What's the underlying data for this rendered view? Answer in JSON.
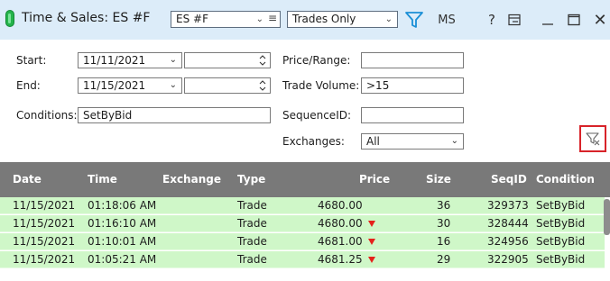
{
  "window": {
    "title": "Time & Sales: ES #F",
    "symbol": "ES #F",
    "filter_mode": "Trades Only",
    "ms_label": "MS",
    "help_label": "?"
  },
  "filters": {
    "start_label": "Start:",
    "start_date": "11/11/2021",
    "start_time": "",
    "end_label": "End:",
    "end_date": "11/15/2021",
    "end_time": "",
    "conditions_label": "Conditions:",
    "conditions_value": "SetByBid",
    "price_range_label": "Price/Range:",
    "price_range_value": "",
    "trade_volume_label": "Trade Volume:",
    "trade_volume_value": ">15",
    "sequence_id_label": "SequenceID:",
    "sequence_id_value": "",
    "exchanges_label": "Exchanges:",
    "exchanges_value": "All"
  },
  "grid": {
    "columns": [
      "Date",
      "Time",
      "Exchange",
      "Type",
      "Price",
      "Size",
      "SeqID",
      "Condition"
    ],
    "rows": [
      {
        "date": "11/15/2021",
        "time": "01:18:06 AM",
        "exchange": "",
        "type": "Trade",
        "price": "4680.00",
        "tick": "",
        "size": "36",
        "seqid": "329373",
        "condition": "SetByBid"
      },
      {
        "date": "11/15/2021",
        "time": "01:16:10 AM",
        "exchange": "",
        "type": "Trade",
        "price": "4680.00",
        "tick": "down",
        "size": "30",
        "seqid": "328444",
        "condition": "SetByBid"
      },
      {
        "date": "11/15/2021",
        "time": "01:10:01 AM",
        "exchange": "",
        "type": "Trade",
        "price": "4681.00",
        "tick": "down",
        "size": "16",
        "seqid": "324956",
        "condition": "SetByBid"
      },
      {
        "date": "11/15/2021",
        "time": "01:05:21 AM",
        "exchange": "",
        "type": "Trade",
        "price": "4681.25",
        "tick": "down",
        "size": "29",
        "seqid": "322905",
        "condition": "SetByBid"
      }
    ]
  },
  "colors": {
    "title_bar": "#dcecf9",
    "header_bg": "#797979",
    "row_bg": "#cff7c8",
    "down_tick": "#e5221b",
    "highlight_box": "#d8232a",
    "accent": "#1a8fd6"
  }
}
